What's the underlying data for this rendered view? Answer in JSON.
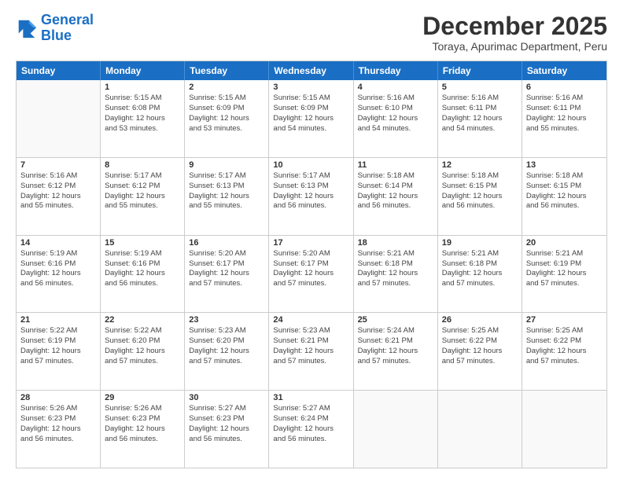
{
  "logo": {
    "line1": "General",
    "line2": "Blue"
  },
  "title": "December 2025",
  "location": "Toraya, Apurimac Department, Peru",
  "days_of_week": [
    "Sunday",
    "Monday",
    "Tuesday",
    "Wednesday",
    "Thursday",
    "Friday",
    "Saturday"
  ],
  "weeks": [
    [
      {
        "day": "",
        "sunrise": "",
        "sunset": "",
        "daylight": ""
      },
      {
        "day": "1",
        "sunrise": "Sunrise: 5:15 AM",
        "sunset": "Sunset: 6:08 PM",
        "daylight": "Daylight: 12 hours",
        "daylight2": "and 53 minutes."
      },
      {
        "day": "2",
        "sunrise": "Sunrise: 5:15 AM",
        "sunset": "Sunset: 6:09 PM",
        "daylight": "Daylight: 12 hours",
        "daylight2": "and 53 minutes."
      },
      {
        "day": "3",
        "sunrise": "Sunrise: 5:15 AM",
        "sunset": "Sunset: 6:09 PM",
        "daylight": "Daylight: 12 hours",
        "daylight2": "and 54 minutes."
      },
      {
        "day": "4",
        "sunrise": "Sunrise: 5:16 AM",
        "sunset": "Sunset: 6:10 PM",
        "daylight": "Daylight: 12 hours",
        "daylight2": "and 54 minutes."
      },
      {
        "day": "5",
        "sunrise": "Sunrise: 5:16 AM",
        "sunset": "Sunset: 6:11 PM",
        "daylight": "Daylight: 12 hours",
        "daylight2": "and 54 minutes."
      },
      {
        "day": "6",
        "sunrise": "Sunrise: 5:16 AM",
        "sunset": "Sunset: 6:11 PM",
        "daylight": "Daylight: 12 hours",
        "daylight2": "and 55 minutes."
      }
    ],
    [
      {
        "day": "7",
        "sunrise": "Sunrise: 5:16 AM",
        "sunset": "Sunset: 6:12 PM",
        "daylight": "Daylight: 12 hours",
        "daylight2": "and 55 minutes."
      },
      {
        "day": "8",
        "sunrise": "Sunrise: 5:17 AM",
        "sunset": "Sunset: 6:12 PM",
        "daylight": "Daylight: 12 hours",
        "daylight2": "and 55 minutes."
      },
      {
        "day": "9",
        "sunrise": "Sunrise: 5:17 AM",
        "sunset": "Sunset: 6:13 PM",
        "daylight": "Daylight: 12 hours",
        "daylight2": "and 55 minutes."
      },
      {
        "day": "10",
        "sunrise": "Sunrise: 5:17 AM",
        "sunset": "Sunset: 6:13 PM",
        "daylight": "Daylight: 12 hours",
        "daylight2": "and 56 minutes."
      },
      {
        "day": "11",
        "sunrise": "Sunrise: 5:18 AM",
        "sunset": "Sunset: 6:14 PM",
        "daylight": "Daylight: 12 hours",
        "daylight2": "and 56 minutes."
      },
      {
        "day": "12",
        "sunrise": "Sunrise: 5:18 AM",
        "sunset": "Sunset: 6:15 PM",
        "daylight": "Daylight: 12 hours",
        "daylight2": "and 56 minutes."
      },
      {
        "day": "13",
        "sunrise": "Sunrise: 5:18 AM",
        "sunset": "Sunset: 6:15 PM",
        "daylight": "Daylight: 12 hours",
        "daylight2": "and 56 minutes."
      }
    ],
    [
      {
        "day": "14",
        "sunrise": "Sunrise: 5:19 AM",
        "sunset": "Sunset: 6:16 PM",
        "daylight": "Daylight: 12 hours",
        "daylight2": "and 56 minutes."
      },
      {
        "day": "15",
        "sunrise": "Sunrise: 5:19 AM",
        "sunset": "Sunset: 6:16 PM",
        "daylight": "Daylight: 12 hours",
        "daylight2": "and 56 minutes."
      },
      {
        "day": "16",
        "sunrise": "Sunrise: 5:20 AM",
        "sunset": "Sunset: 6:17 PM",
        "daylight": "Daylight: 12 hours",
        "daylight2": "and 57 minutes."
      },
      {
        "day": "17",
        "sunrise": "Sunrise: 5:20 AM",
        "sunset": "Sunset: 6:17 PM",
        "daylight": "Daylight: 12 hours",
        "daylight2": "and 57 minutes."
      },
      {
        "day": "18",
        "sunrise": "Sunrise: 5:21 AM",
        "sunset": "Sunset: 6:18 PM",
        "daylight": "Daylight: 12 hours",
        "daylight2": "and 57 minutes."
      },
      {
        "day": "19",
        "sunrise": "Sunrise: 5:21 AM",
        "sunset": "Sunset: 6:18 PM",
        "daylight": "Daylight: 12 hours",
        "daylight2": "and 57 minutes."
      },
      {
        "day": "20",
        "sunrise": "Sunrise: 5:21 AM",
        "sunset": "Sunset: 6:19 PM",
        "daylight": "Daylight: 12 hours",
        "daylight2": "and 57 minutes."
      }
    ],
    [
      {
        "day": "21",
        "sunrise": "Sunrise: 5:22 AM",
        "sunset": "Sunset: 6:19 PM",
        "daylight": "Daylight: 12 hours",
        "daylight2": "and 57 minutes."
      },
      {
        "day": "22",
        "sunrise": "Sunrise: 5:22 AM",
        "sunset": "Sunset: 6:20 PM",
        "daylight": "Daylight: 12 hours",
        "daylight2": "and 57 minutes."
      },
      {
        "day": "23",
        "sunrise": "Sunrise: 5:23 AM",
        "sunset": "Sunset: 6:20 PM",
        "daylight": "Daylight: 12 hours",
        "daylight2": "and 57 minutes."
      },
      {
        "day": "24",
        "sunrise": "Sunrise: 5:23 AM",
        "sunset": "Sunset: 6:21 PM",
        "daylight": "Daylight: 12 hours",
        "daylight2": "and 57 minutes."
      },
      {
        "day": "25",
        "sunrise": "Sunrise: 5:24 AM",
        "sunset": "Sunset: 6:21 PM",
        "daylight": "Daylight: 12 hours",
        "daylight2": "and 57 minutes."
      },
      {
        "day": "26",
        "sunrise": "Sunrise: 5:25 AM",
        "sunset": "Sunset: 6:22 PM",
        "daylight": "Daylight: 12 hours",
        "daylight2": "and 57 minutes."
      },
      {
        "day": "27",
        "sunrise": "Sunrise: 5:25 AM",
        "sunset": "Sunset: 6:22 PM",
        "daylight": "Daylight: 12 hours",
        "daylight2": "and 57 minutes."
      }
    ],
    [
      {
        "day": "28",
        "sunrise": "Sunrise: 5:26 AM",
        "sunset": "Sunset: 6:23 PM",
        "daylight": "Daylight: 12 hours",
        "daylight2": "and 56 minutes."
      },
      {
        "day": "29",
        "sunrise": "Sunrise: 5:26 AM",
        "sunset": "Sunset: 6:23 PM",
        "daylight": "Daylight: 12 hours",
        "daylight2": "and 56 minutes."
      },
      {
        "day": "30",
        "sunrise": "Sunrise: 5:27 AM",
        "sunset": "Sunset: 6:23 PM",
        "daylight": "Daylight: 12 hours",
        "daylight2": "and 56 minutes."
      },
      {
        "day": "31",
        "sunrise": "Sunrise: 5:27 AM",
        "sunset": "Sunset: 6:24 PM",
        "daylight": "Daylight: 12 hours",
        "daylight2": "and 56 minutes."
      },
      {
        "day": "",
        "sunrise": "",
        "sunset": "",
        "daylight": "",
        "daylight2": ""
      },
      {
        "day": "",
        "sunrise": "",
        "sunset": "",
        "daylight": "",
        "daylight2": ""
      },
      {
        "day": "",
        "sunrise": "",
        "sunset": "",
        "daylight": "",
        "daylight2": ""
      }
    ]
  ]
}
